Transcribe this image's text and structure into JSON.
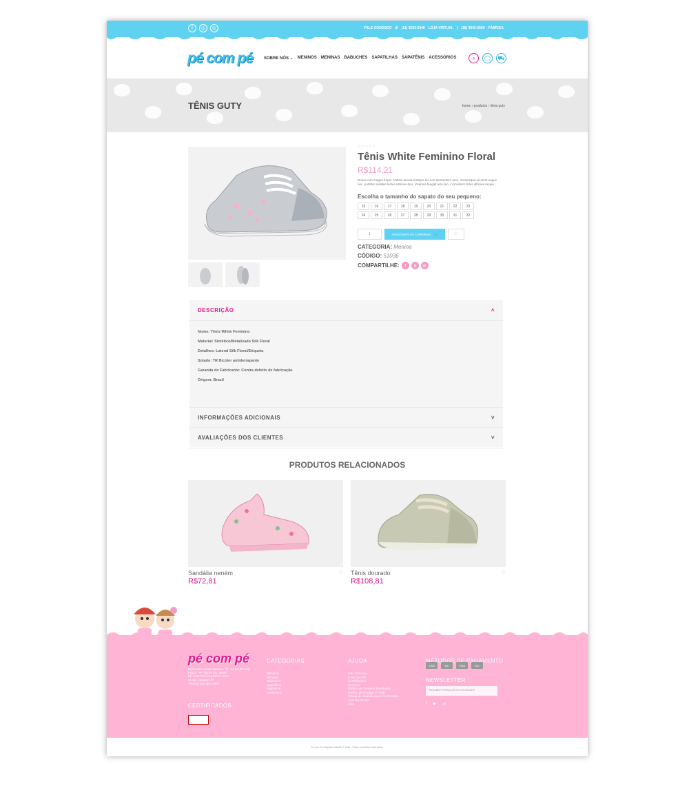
{
  "topbar": {
    "social": [
      "f",
      "◎",
      "◎"
    ],
    "contact_label": "FALE CONOSCO",
    "phone1": "(11) 3593-5340",
    "store_label": "LOJA VIRTUAL",
    "phone2": "(18) 3643-5500",
    "factory_label": "FÁBRICA"
  },
  "header": {
    "logo": "pé com pé",
    "nav": [
      "SOBRE NÓS ⌄",
      "MENINOS",
      "MENINAS",
      "BABUCHES",
      "SAPATILHAS",
      "SAPATÊNIS",
      "ACESSÓRIOS"
    ]
  },
  "banner": {
    "title": "TÊNIS GUTY",
    "breadcrumb": [
      "home",
      "›",
      "produtos",
      "›",
      "tênis guty"
    ]
  },
  "product": {
    "stars": "☆☆☆☆☆",
    "title": "Tênis White Feminino Floral",
    "price": "R$114,21",
    "description": "Donec non magna turpis. Nullam lacinia tristique leo non elementum arcu, scelerisque sit amet augue nec, porttitor sodales lectus ultricies duo. Vivamus feugiat arcu leo, in tincidunt tellus ultricies neque...",
    "size_label": "Escolha o tamanho do sapato do seu pequeno:",
    "sizes": [
      "15",
      "16",
      "17",
      "18",
      "19",
      "20",
      "21",
      "22",
      "23",
      "24",
      "25",
      "26",
      "27",
      "28",
      "29",
      "30",
      "31",
      "32"
    ],
    "qty": "1",
    "add_to_cart": "ADICIONAR AO CARRINHO",
    "category_label": "CATEGORIA",
    "category": "Menina",
    "code_label": "CÓDIGO",
    "code": "51036",
    "share_label": "COMPARTILHE:"
  },
  "tabs": {
    "description": "DESCRIÇÃO",
    "details": [
      "Nome: Tênis White Feminino",
      "Material: Sintético/Metalizado Silk Floral",
      "Detalhes: Lateral Silk Floral/Etiqueta",
      "Solado: TR Bicolor antiderrapante",
      "Garantia do Fabricante: Contra defeito de fabricação",
      "Origem: Brasil"
    ],
    "additional": "INFORMAÇÕES ADICIONAIS",
    "reviews": "AVALIAÇÕES DOS CLIENTES"
  },
  "related": {
    "title": "PRODUTOS RELACIONADOS",
    "items": [
      {
        "name": "Sandália neném",
        "price": "R$72,81"
      },
      {
        "name": "Tênis dourado",
        "price": "R$108,81"
      }
    ]
  },
  "footer": {
    "logo": "pé com pé",
    "address": "Rua Pedro Canale Ramires, 71 - Jardim Paraíso, Birigui - SP, 16204-341, Brasil\nPÉ COM PÉ CALÇADOS LTDA -\n51.361.130/0001-23\nTelefone (18) 3643-5500",
    "certificates": "CERTIFICADOS",
    "categories_title": "CATEGORIAS",
    "categories": [
      "Meninos",
      "Meninas",
      "Babuches",
      "Sapatilhas",
      "Sapatênis",
      "Acessórios"
    ],
    "help_title": "AJUDA",
    "help": [
      "Fale Conosco",
      "A Pé com Pé",
      "Certificações",
      "Serviços",
      "Política de Trocas e Devolução",
      "Política de Entrega e Frete",
      "Tabela de Referência de Numeração",
      "Área do Cliente",
      "Loja"
    ],
    "payment_title": "MÉTODOS DE PAGAMENTO",
    "cards": [
      "VISA",
      "MC",
      "VISA",
      "MC"
    ],
    "newsletter_title": "NEWSLETTER",
    "newsletter_placeholder": "RECEBER PROMOÇÕES E NOVIDADES",
    "copyright": "Pé com Pé Calçados Infantis © 2016 - Todos os direitos reservados."
  },
  "colors": {
    "accent_blue": "#5fd2f2",
    "accent_pink": "#e0198b",
    "footer_pink": "#ffb3d5"
  }
}
